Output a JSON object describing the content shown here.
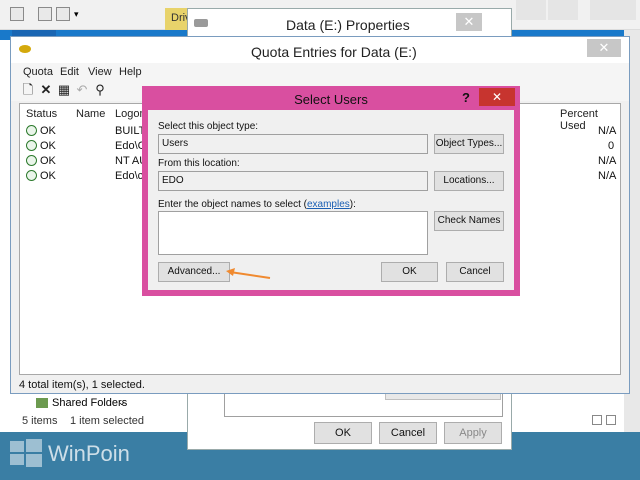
{
  "explorer": {
    "drive_tools_label": "Driv",
    "nav_item": "Shared Folders",
    "status_items": "5 items",
    "status_selected": "1 item selected"
  },
  "properties": {
    "title": "Data (E:) Properties",
    "close_glyph": "✕",
    "ok_label": "OK",
    "cancel_label": "Cancel",
    "apply_label": "Apply"
  },
  "quota": {
    "title": "Quota Entries for Data (E:)",
    "close_glyph": "✕",
    "menu": [
      "Quota",
      "Edit",
      "View",
      "Help"
    ],
    "columns": [
      "Status",
      "Name",
      "Logon",
      "Percent Used"
    ],
    "rows": [
      {
        "status": "OK",
        "logon": "BUILTI",
        "percent": "N/A"
      },
      {
        "status": "OK",
        "logon": "Edo\\Gu",
        "percent": "0"
      },
      {
        "status": "OK",
        "logon": "NT AU",
        "percent": "N/A"
      },
      {
        "status": "OK",
        "logon": "Edo\\ch",
        "percent": "N/A"
      }
    ],
    "status_text": "4 total item(s), 1 selected."
  },
  "dialog": {
    "title": "Select Users",
    "help_glyph": "?",
    "close_glyph": "✕",
    "object_type_label": "Select this object type:",
    "object_type_value": "Users",
    "object_types_button": "Object Types...",
    "location_label": "From this location:",
    "location_value": "EDO",
    "locations_button": "Locations...",
    "names_label_pre": "Enter the object names to select (",
    "names_label_link": "examples",
    "names_label_post": "):",
    "check_names_button": "Check Names",
    "advanced_button": "Advanced...",
    "ok_button": "OK",
    "cancel_button": "Cancel"
  },
  "watermark": {
    "text": "WinPoin"
  },
  "colors": {
    "dialog_frame": "#d94fa0",
    "close_red": "#c7342f",
    "arrow": "#f08a30",
    "link": "#1a5fb4"
  }
}
